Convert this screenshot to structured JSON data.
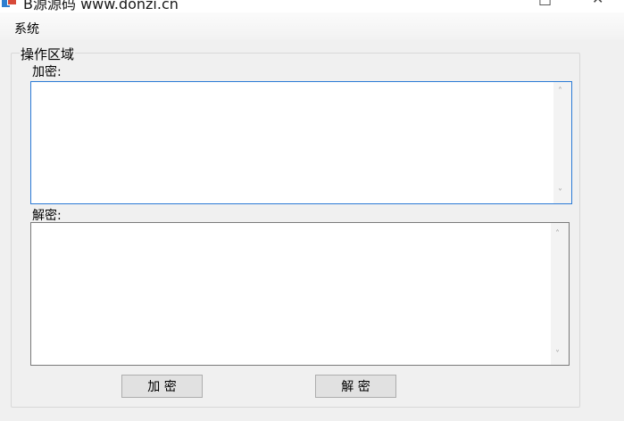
{
  "window": {
    "title": "B源源码 www.donzi.cn",
    "minimize_glyph": "□",
    "close_glyph": "✕"
  },
  "menu": {
    "items": [
      {
        "label": "系统"
      }
    ]
  },
  "groupbox": {
    "title": "操作区域",
    "encrypt_label": "加密:",
    "decrypt_label": "解密:",
    "encrypt_text": "",
    "decrypt_text": ""
  },
  "buttons": {
    "encrypt": "加 密",
    "decrypt": "解 密"
  },
  "scroll": {
    "up": "˄",
    "down": "˅"
  },
  "icons": {
    "app": "app-icon",
    "scroll_up": "chevron-up-icon",
    "scroll_down": "chevron-down-icon"
  },
  "colors": {
    "focus_border": "#2b7ad6",
    "window_bg": "#f0f0f0",
    "button_bg": "#e1e1e1"
  }
}
